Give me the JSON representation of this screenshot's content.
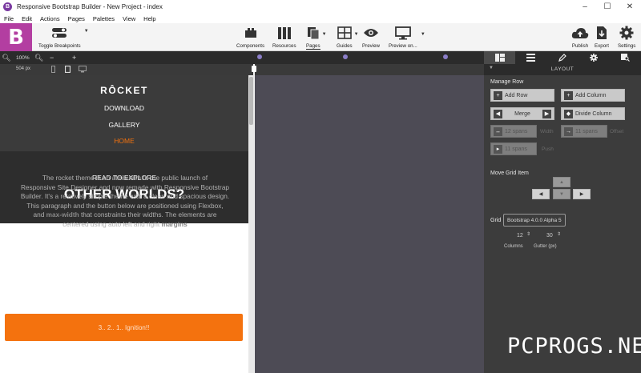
{
  "window": {
    "title": "Responsive Bootstrap Builder - New Project - index",
    "app_icon": "B",
    "controls": [
      "–",
      "☐",
      "✕"
    ]
  },
  "menu": [
    "File",
    "Edit",
    "Actions",
    "Pages",
    "Palettes",
    "View",
    "Help"
  ],
  "toolbar": {
    "logo": "B",
    "toggle_breakpoints": "Toggle Breakpoints",
    "components": "Components",
    "resources": "Resources",
    "pages": "Pages",
    "guides": "Guides",
    "preview": "Preview",
    "preview_on": "Preview on...",
    "publish": "Publish",
    "export": "Export",
    "settings": "Settings"
  },
  "zoom": {
    "minus": "−",
    "plus": "+",
    "value": "100%",
    "width_label": "504 px"
  },
  "preview": {
    "brand": "RÔCKET",
    "nav_links": [
      "DOWNLOAD",
      "GALLERY",
      "HOME"
    ],
    "hero_sub": "READ TO EXPLORE",
    "hero_title": "OTHER WORLDS?",
    "body_line1": "The rocket theme is an attribution to the public launch of",
    "body_line2": "Responsive Site Designer and now remade with Responsive Bootstrap",
    "body_line3": "Builder. It's a relatively simple theme with a clean and spacious design.",
    "body_line4": "This paragraph and the button below are positioned using Flexbox,",
    "body_line5a": "and ",
    "body_bold1": "max-width",
    "body_line5b": " that constraints their widths. The elements are",
    "body_line6a": "centered using auto left and right ",
    "body_bold2": "margins",
    "cta": "3.. 2.. 1.. Ignition!!"
  },
  "panel": {
    "header": "LAYOUT",
    "manage_row": "Manage Row",
    "add_row": "Add Row",
    "add_column": "Add Column",
    "merge": "Merge",
    "divide_column": "Divide Column",
    "width_select": "12 spans",
    "width_label": "Width",
    "offset_select": "11 spans",
    "offset_label": "Offset",
    "push_select": "11 spans",
    "push_label": "Push",
    "move_grid_item": "Move Grid Item",
    "grid_label": "Grid",
    "grid_select": "Bootstrap 4.0.0 Alpha 5",
    "columns_value": "12",
    "gutter_value": "30",
    "columns_label": "Columns",
    "gutter_label": "Gutter (px)"
  },
  "watermark": "PCPROGS.NET",
  "colors": {
    "brand": "#b33ea1",
    "cta": "#f4720e",
    "active_link": "#f4720e",
    "breakpoint_dot": "#8b7ec8"
  }
}
